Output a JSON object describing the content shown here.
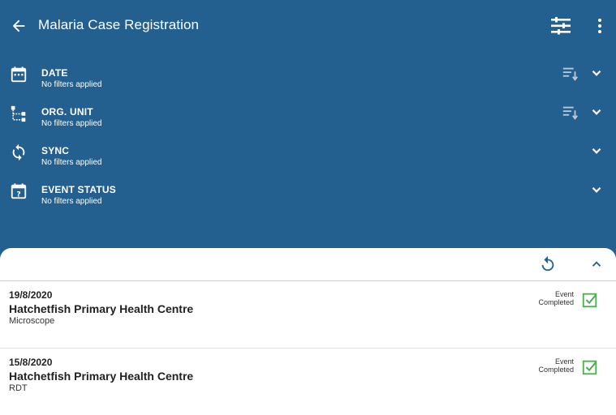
{
  "appbar": {
    "title": "Malaria Case Registration",
    "back_icon": "arrow-back-icon",
    "filter_icon": "filter-list-icon",
    "more_icon": "more-vert-icon"
  },
  "filters": [
    {
      "label": "DATE",
      "status": "No filters applied",
      "icon": "calendar-icon",
      "sortable": true
    },
    {
      "label": "ORG. UNIT",
      "status": "No filters applied",
      "icon": "org-tree-icon",
      "sortable": true
    },
    {
      "label": "SYNC",
      "status": "No filters applied",
      "icon": "sync-icon",
      "sortable": false
    },
    {
      "label": "EVENT STATUS",
      "status": "No filters applied",
      "icon": "event-status-icon",
      "sortable": false
    }
  ],
  "events": [
    {
      "date": "19/8/2020",
      "org_unit": "Hatchetfish Primary Health Centre",
      "program_stage": "Microscope",
      "status_line1": "Event",
      "status_line2": "Completed"
    },
    {
      "date": "15/8/2020",
      "org_unit": "Hatchetfish Primary Health Centre",
      "program_stage": "RDT",
      "status_line1": "Event",
      "status_line2": "Completed"
    }
  ],
  "colors": {
    "primary": "#24608f",
    "completed": "#4caf50",
    "action_icon": "#24608f"
  }
}
